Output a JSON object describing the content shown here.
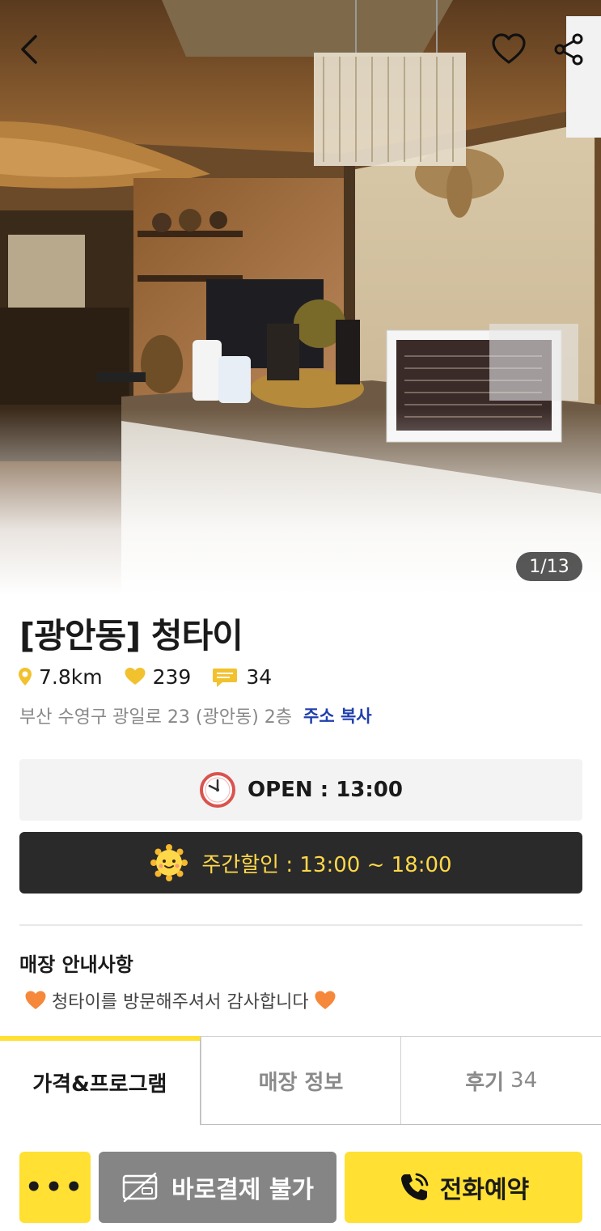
{
  "header": {
    "back_icon": "chevron-left-icon",
    "favorite_icon": "heart-outline-icon",
    "share_icon": "share-icon",
    "photo_counter": "1/13"
  },
  "store": {
    "title": "[광안동] 청타이",
    "distance": "7.8km",
    "likes": "239",
    "reviews": "34",
    "address": "부산 수영구 광일로 23 (광안동) 2층",
    "copy_address_label": "주소 복사",
    "open_time": "OPEN : 13:00",
    "weekday_discount": "주간할인 : 13:00 ~ 18:00"
  },
  "notice": {
    "title": "매장 안내사항",
    "text": "청타이를 방문해주셔서 감사합니다"
  },
  "tabs": [
    {
      "label": "가격&프로그램",
      "count": "",
      "active": true
    },
    {
      "label": "매장 정보",
      "count": "",
      "active": false
    },
    {
      "label": "후기",
      "count": "34",
      "active": false
    }
  ],
  "bottom_bar": {
    "more_label": "•••",
    "pay_label": "바로결제 불가",
    "call_label": "전화예약"
  },
  "colors": {
    "accent_yellow": "#ffe033",
    "discount_text": "#ffd84a",
    "link_blue": "#1f3fae",
    "dark_box": "#2a2a2a",
    "disabled_gray": "#858585"
  }
}
